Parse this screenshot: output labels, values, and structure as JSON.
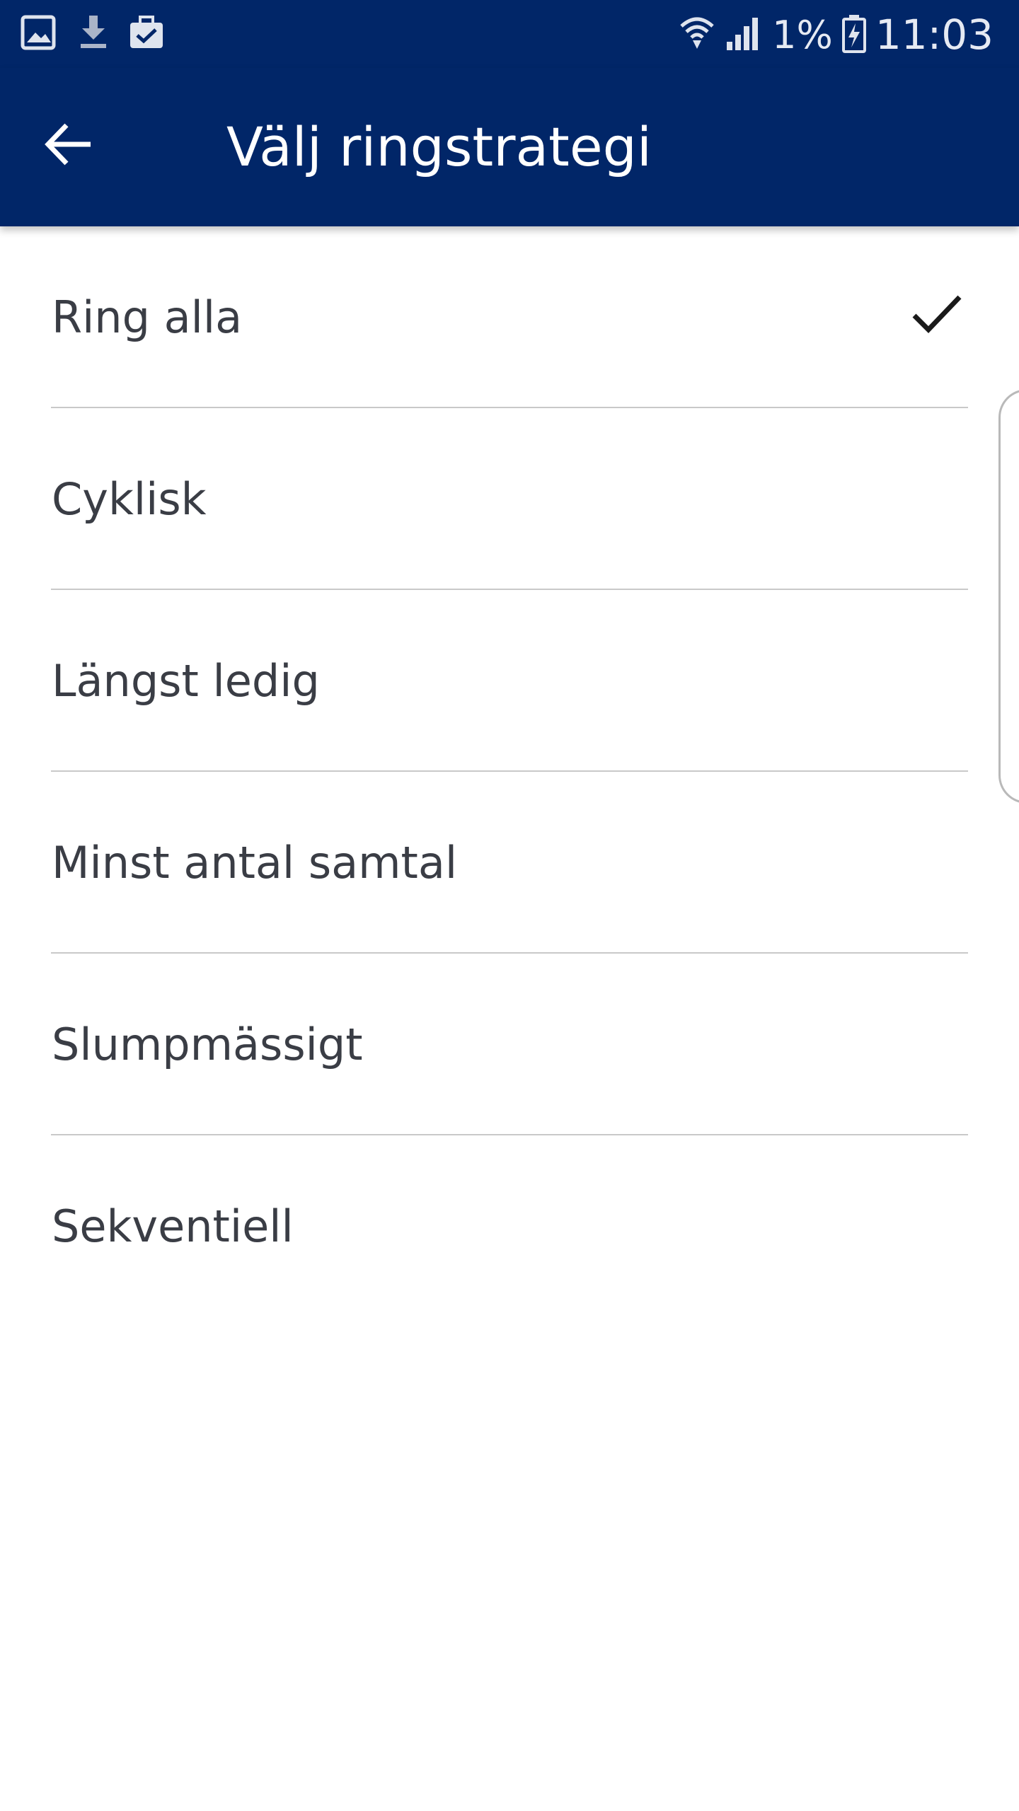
{
  "status_bar": {
    "icons_left": [
      "gallery-icon",
      "download-icon",
      "briefcase-check-icon"
    ],
    "icons_right": [
      "wifi-icon",
      "signal-icon",
      "battery-charging-icon"
    ],
    "battery_percent": "1%",
    "time": "11:03"
  },
  "app_bar": {
    "back_icon": "arrow-left-icon",
    "title": "Välj ringstrategi"
  },
  "strategies": {
    "items": [
      {
        "label": "Ring alla",
        "selected": true
      },
      {
        "label": "Cyklisk",
        "selected": false
      },
      {
        "label": "Längst ledig",
        "selected": false
      },
      {
        "label": "Minst antal samtal",
        "selected": false
      },
      {
        "label": "Slumpmässigt",
        "selected": false
      },
      {
        "label": "Sekventiell",
        "selected": false
      }
    ]
  },
  "colors": {
    "primary": "#012668",
    "text": "#3a3d45",
    "divider": "#c9c9c9",
    "background": "#ffffff"
  }
}
